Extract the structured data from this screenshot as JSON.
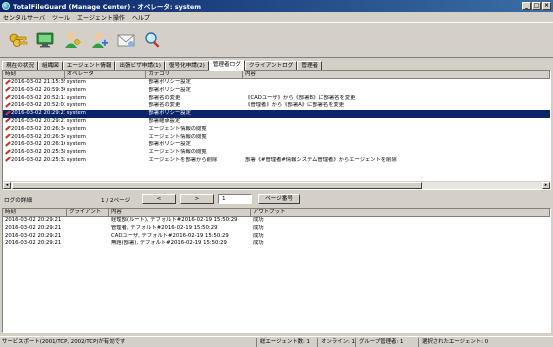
{
  "window": {
    "title": "TotalFileGuard (Manage Center) - オペレータ: system"
  },
  "menu": [
    "センタルサーバ",
    "ツール",
    "エージェント操作",
    "ヘルプ"
  ],
  "toolbar": {
    "buttons": [
      {
        "name": "keys-icon"
      },
      {
        "name": "monitor-icon"
      },
      {
        "name": "user-key-icon"
      },
      {
        "name": "user-add-icon"
      },
      {
        "name": "mail-icon"
      },
      {
        "name": "magnifier-icon"
      }
    ]
  },
  "tabs": [
    {
      "label": "現在の状況",
      "active": false
    },
    {
      "label": "組織図",
      "active": false
    },
    {
      "label": "エージェント情報",
      "active": false
    },
    {
      "label": "出張ビザ申請(1)",
      "active": false
    },
    {
      "label": "復号化申請(2)",
      "active": false
    },
    {
      "label": "管理者ログ",
      "active": true
    },
    {
      "label": "クライアントログ",
      "active": false
    },
    {
      "label": "管理者",
      "active": false
    }
  ],
  "upper_table": {
    "headers": [
      "時刻",
      "オペレータ",
      "カテゴリ",
      "内容"
    ],
    "rows": [
      {
        "time": "2016-03-02 21:15:39",
        "op": "system",
        "cat": "部署ポリシー設定",
        "content": "",
        "selected": false
      },
      {
        "time": "2016-03-02 20:59:36",
        "op": "system",
        "cat": "部署ポリシー設定",
        "content": "",
        "selected": false
      },
      {
        "time": "2016-03-02 20:52:11",
        "op": "system",
        "cat": "部署名の変更",
        "content": "《CADユーザ》から《部署B》に部署名を変更",
        "selected": false
      },
      {
        "time": "2016-03-02 20:52:01",
        "op": "system",
        "cat": "部署名の変更",
        "content": "《管理者》から《部署A》に部署名を変更",
        "selected": false
      },
      {
        "time": "2016-03-02 20:29:21",
        "op": "system",
        "cat": "部署ポリシー設定",
        "content": "",
        "selected": true
      },
      {
        "time": "2016-03-02 20:29:21",
        "op": "system",
        "cat": "部署継承設定",
        "content": "",
        "selected": false
      },
      {
        "time": "2016-03-02 20:26:34",
        "op": "system",
        "cat": "エージェント情報の閲覧",
        "content": "",
        "selected": false
      },
      {
        "time": "2016-03-02 20:26:34",
        "op": "system",
        "cat": "エージェント情報の閲覧",
        "content": "",
        "selected": false
      },
      {
        "time": "2016-03-02 20:26:16",
        "op": "system",
        "cat": "部署ポリシー設定",
        "content": "",
        "selected": false
      },
      {
        "time": "2016-03-02 20:25:38",
        "op": "system",
        "cat": "エージェント情報の閲覧",
        "content": "",
        "selected": false
      },
      {
        "time": "2016-03-02 20:25:32",
        "op": "system",
        "cat": "エージェントを部署から削除",
        "content": "部署《#管理者#情報システム管理者》からエージェントを削除",
        "selected": false
      }
    ]
  },
  "detail": {
    "label": "ログの詳細",
    "page_info": "1 / 2ページ",
    "prev": "<",
    "next": ">",
    "page_value": "1",
    "goto_label": "ページ番号"
  },
  "lower_table": {
    "headers": [
      "時刻",
      "クライアント",
      "内容",
      "アウトプット"
    ],
    "rows": [
      {
        "time": "2016-03-02 20:29:21",
        "client": "",
        "content": "経理部(ルート), デフォルト#2016-02-19 15:50:29",
        "output": "成功"
      },
      {
        "time": "2016-03-02 20:29:21",
        "client": "",
        "content": "管理者, デフォルト#2016-02-19 15:50:29",
        "output": "成功"
      },
      {
        "time": "2016-03-02 20:29:21",
        "client": "",
        "content": "CADユーザ, デフォルト#2016-02-19 15:50:29",
        "output": "成功"
      },
      {
        "time": "2016-03-02 20:29:21",
        "client": "",
        "content": "無題(部署), デフォルト#2016-02-19 15:50:29",
        "output": "成功"
      }
    ]
  },
  "status": {
    "service": "サービスポート(2001/TCP, 2002/TCP)が有効です",
    "agents": "総エージェント数: 1",
    "online": "オンライン: 1",
    "group": "グループ管理者: 1",
    "selected": "選択されたエージェント: 0"
  }
}
